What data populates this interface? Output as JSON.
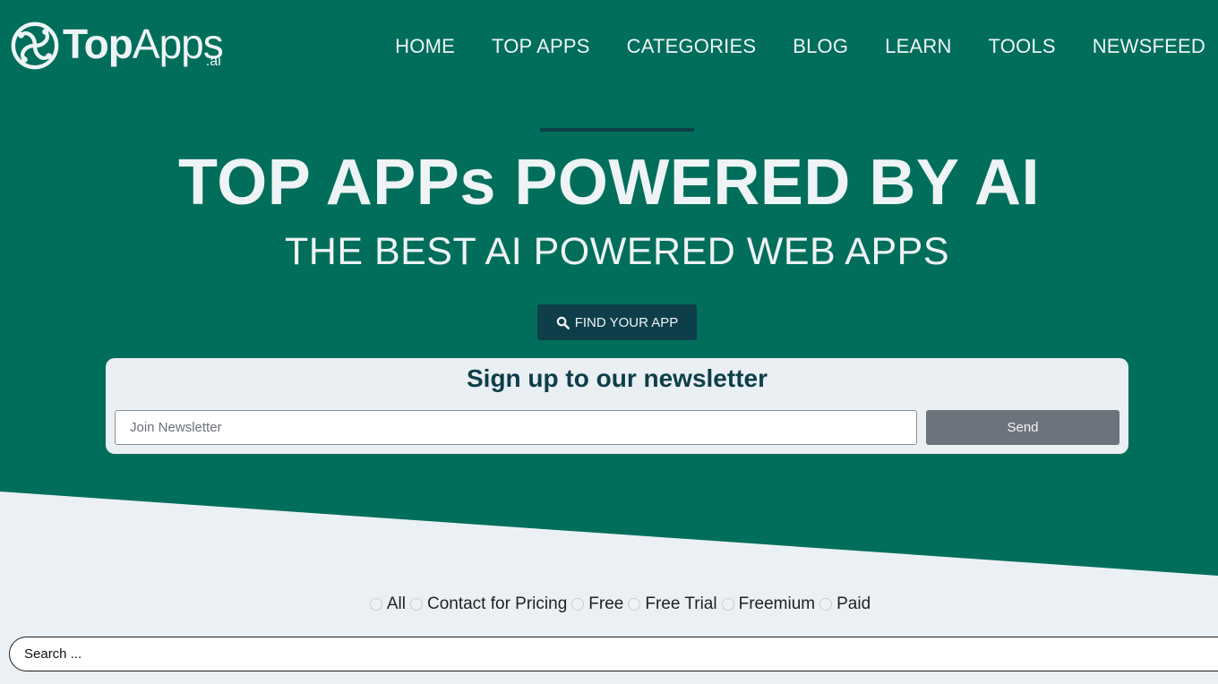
{
  "brand": {
    "logo_bold": "Top",
    "logo_light": "Apps",
    "logo_suffix": ".ai"
  },
  "nav": {
    "items": [
      {
        "label": "HOME"
      },
      {
        "label": "TOP APPS"
      },
      {
        "label": "CATEGORIES"
      },
      {
        "label": "BLOG"
      },
      {
        "label": "LEARN"
      },
      {
        "label": "TOOLS"
      },
      {
        "label": "NEWSFEED"
      }
    ]
  },
  "hero": {
    "title": "TOP APPs POWERED BY AI",
    "subtitle": "THE BEST AI POWERED WEB APPS",
    "cta_label": "FIND YOUR APP",
    "cta_icon": "search-icon"
  },
  "newsletter": {
    "heading": "Sign up to our newsletter",
    "input_placeholder": "Join Newsletter",
    "input_value": "",
    "send_label": "Send"
  },
  "filters": {
    "options": [
      {
        "label": "All",
        "checked": false
      },
      {
        "label": "Contact for Pricing",
        "checked": false
      },
      {
        "label": "Free",
        "checked": false
      },
      {
        "label": "Free Trial",
        "checked": false
      },
      {
        "label": "Freemium",
        "checked": false
      },
      {
        "label": "Paid",
        "checked": false
      }
    ]
  },
  "search": {
    "placeholder": "Search ...",
    "value": ""
  },
  "colors": {
    "brand_green": "#006e5b",
    "dark_teal": "#0e3e4a",
    "light_bg": "#eaf0f4",
    "send_gray": "#6c737c"
  }
}
